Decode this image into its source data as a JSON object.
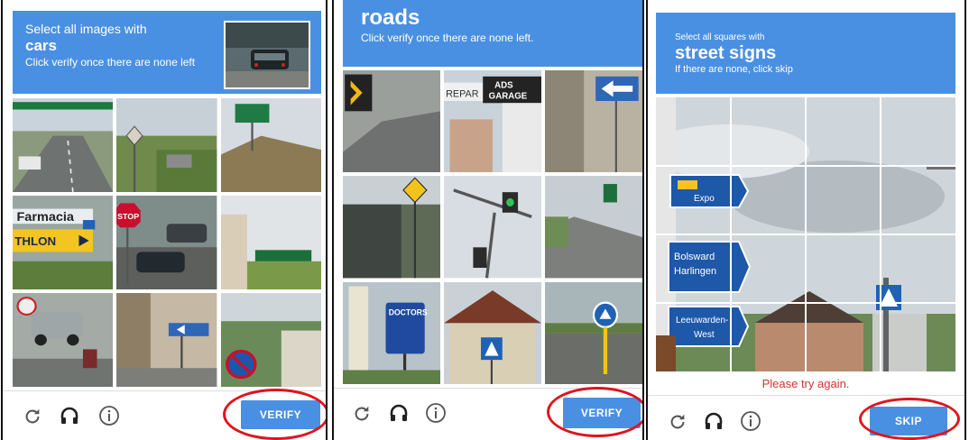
{
  "panel1": {
    "instruction_line1": "Select all images with",
    "target": "cars",
    "instruction_line2": "Click verify once there are none left",
    "tile_labels": [
      "Farmacia",
      "THLON",
      "STOP"
    ],
    "button": "VERIFY"
  },
  "panel2": {
    "target": "roads",
    "instruction_line2": "Click verify once there are none left.",
    "tile_labels": [
      "REPAR",
      "ADS",
      "GARAGE",
      "DOCTORS"
    ],
    "button": "VERIFY"
  },
  "panel3": {
    "instruction_line1": "Select all squares with",
    "target": "street signs",
    "instruction_line2": "If there are none, click skip",
    "sign_labels": [
      "Expo",
      "Bolsward",
      "Harlingen",
      "Leeuwarden-",
      "West"
    ],
    "error": "Please try again.",
    "button": "SKIP"
  },
  "colors": {
    "accent": "#4a90e2",
    "highlight_ring": "#e0141e",
    "error": "#d0342c"
  },
  "icons": [
    "reload-icon",
    "headphones-icon",
    "info-icon"
  ]
}
